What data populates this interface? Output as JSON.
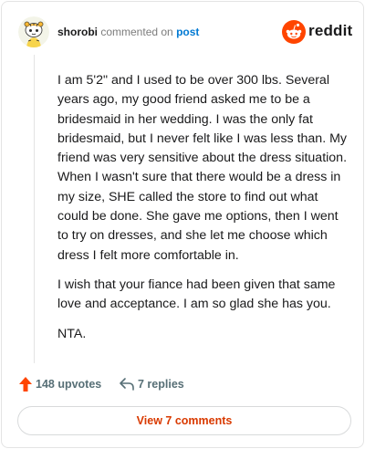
{
  "header": {
    "username": "shorobi",
    "action_text": "commented on",
    "post_link": "post",
    "avatar_icon": "snoo-avatar-icon",
    "brand_icon": "reddit-logo-icon",
    "brand_word": "reddit"
  },
  "comment": {
    "paragraphs": [
      "I am 5'2\" and I used to be over 300 lbs. Several years ago, my good friend asked me to be a bridesmaid in her wedding. I was the only fat bridesmaid, but I never felt like I was less than. My friend was very sensitive about the dress situation. When I wasn't sure that there would be a dress in my size, SHE called the store to find out what could be done. She gave me options, then I went to try on dresses, and she let me choose which dress I felt more comfortable in.",
      "I wish that your fiance had been given that same love and acceptance. I am so glad she has you.",
      "NTA."
    ]
  },
  "actions": {
    "upvotes_label": "148 upvotes",
    "replies_label": "7 replies",
    "upvote_icon": "upvote-arrow-icon",
    "reply_icon": "reply-arrow-icon"
  },
  "footer": {
    "view_comments_label": "View 7 comments"
  },
  "colors": {
    "brand_orange": "#ff4500",
    "link_blue": "#0079d3",
    "meta_gray": "#576f76",
    "button_text": "#d93a00"
  }
}
